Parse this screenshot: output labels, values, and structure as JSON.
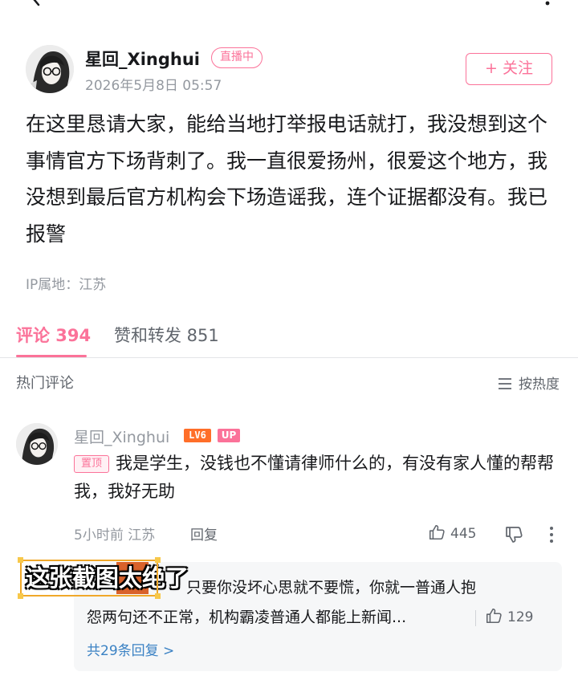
{
  "author": {
    "name": "星回_Xinghui",
    "live_badge": "直播中",
    "time": "2026年5月8日 05:57",
    "follow_label": "+ 关注"
  },
  "post": {
    "text": "在这里恳请大家，能给当地打举报电话就打，我没想到这个事情官方下场背刺了。我一直很爱扬州，很爱这个地方，我没想到最后官方机构会下场造谣我，连个证据都没有。我已报警",
    "ip": "IP属地：江苏"
  },
  "tabs": {
    "comments": "评论 394",
    "likes_reposts": "赞和转发 851"
  },
  "comments_section": {
    "title": "热门评论",
    "sort_label": "按热度"
  },
  "comment": {
    "name": "星回_Xinghui",
    "level": "LV6",
    "up_badge": "UP",
    "pinned": "置顶",
    "text": "我是学生，没钱也不懂请律师什么的，有没有家人懂的帮帮我，我好无助",
    "meta": "5小时前 江苏",
    "reply_label": "回复",
    "likes": "445"
  },
  "reply_preview": {
    "text_line1": "只要你没坏心思就不要慌，你就一普通人抱",
    "text_line2": "怨两句还不正常，机构霸凌普通人都能上新闻...",
    "likes": "129",
    "more_label": "共29条回复 >"
  },
  "caption": {
    "text": "这张截图太绝了"
  },
  "colors": {
    "accent": "#fb7299",
    "level": "#ff6e29",
    "link": "#3b82c4"
  },
  "icons": [
    "back-arrow-icon",
    "more-vertical-icon",
    "sort-lines-icon",
    "thumb-up-icon",
    "thumb-down-icon",
    "kebab-icon"
  ]
}
